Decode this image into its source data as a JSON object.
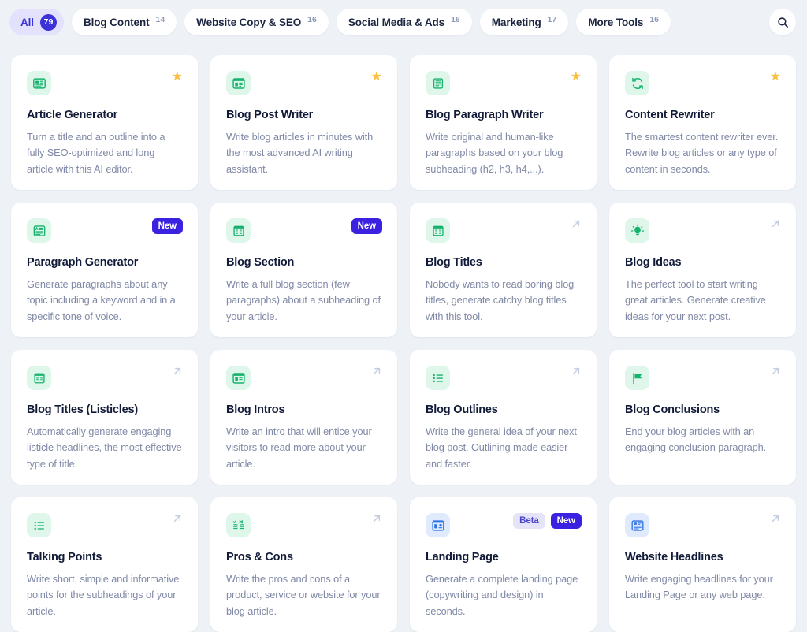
{
  "theme": {
    "page_background": "#eef2f7",
    "accent_indigo": "#3b33d8",
    "badge_new_bg": "#3b21e0",
    "badge_beta_bg": "#e5e3f8",
    "star_color": "#fbbf3c",
    "icon_tile_green": "#dff6ea",
    "icon_tile_blue": "#dfeafc",
    "icon_green": "#16b36e",
    "icon_blue": "#2f72e8"
  },
  "topbar": {
    "search_icon": "search-icon",
    "tabs": [
      {
        "label": "All",
        "count": "79",
        "active": true
      },
      {
        "label": "Blog Content",
        "count": "14",
        "active": false
      },
      {
        "label": "Website Copy & SEO",
        "count": "16",
        "active": false
      },
      {
        "label": "Social Media & Ads",
        "count": "16",
        "active": false
      },
      {
        "label": "Marketing",
        "count": "17",
        "active": false
      },
      {
        "label": "More Tools",
        "count": "16",
        "active": false
      }
    ]
  },
  "cards": [
    {
      "title": "Article Generator",
      "desc": "Turn a title and an outline into a fully SEO-optimized and long article with this AI editor.",
      "icon": "article-icon",
      "icon_color": "green",
      "marker": "star",
      "badges": []
    },
    {
      "title": "Blog Post Writer",
      "desc": "Write blog articles in minutes with the most advanced AI writing assistant.",
      "icon": "blog-post-icon",
      "icon_color": "green",
      "marker": "star",
      "badges": []
    },
    {
      "title": "Blog Paragraph Writer",
      "desc": "Write original and human-like paragraphs based on your blog subheading (h2, h3, h4,...).",
      "icon": "paragraph-lines-icon",
      "icon_color": "green",
      "marker": "star",
      "badges": []
    },
    {
      "title": "Content Rewriter",
      "desc": "The smartest content rewriter ever. Rewrite blog articles or any type of content in seconds.",
      "icon": "refresh-cycle-icon",
      "icon_color": "green",
      "marker": "star",
      "badges": []
    },
    {
      "title": "Paragraph Generator",
      "desc": "Generate paragraphs about any topic including a keyword and in a specific tone of voice.",
      "icon": "paragraph-generator-icon",
      "icon_color": "green",
      "marker": "badges",
      "badges": [
        "New"
      ]
    },
    {
      "title": "Blog Section",
      "desc": "Write a full blog section (few paragraphs) about a subheading of your article.",
      "icon": "blog-section-icon",
      "icon_color": "green",
      "marker": "badges",
      "badges": [
        "New"
      ]
    },
    {
      "title": "Blog Titles",
      "desc": "Nobody wants to read boring blog titles, generate catchy blog titles with this tool.",
      "icon": "blog-titles-icon",
      "icon_color": "green",
      "marker": "arrow",
      "badges": []
    },
    {
      "title": "Blog Ideas",
      "desc": "The perfect tool to start writing great articles. Generate creative ideas for your next post.",
      "icon": "lightbulb-icon",
      "icon_color": "green",
      "marker": "arrow",
      "badges": []
    },
    {
      "title": "Blog Titles (Listicles)",
      "desc": "Automatically generate engaging listicle headlines, the most effective type of title.",
      "icon": "listicle-icon",
      "icon_color": "green",
      "marker": "arrow",
      "badges": []
    },
    {
      "title": "Blog Intros",
      "desc": "Write an intro that will entice your visitors to read more about your article.",
      "icon": "blog-intro-icon",
      "icon_color": "green",
      "marker": "arrow",
      "badges": []
    },
    {
      "title": "Blog Outlines",
      "desc": "Write the general idea of your next blog post. Outlining made easier and faster.",
      "icon": "outline-list-icon",
      "icon_color": "green",
      "marker": "arrow",
      "badges": []
    },
    {
      "title": "Blog Conclusions",
      "desc": "End your blog articles with an engaging conclusion paragraph.",
      "icon": "flag-icon",
      "icon_color": "green",
      "marker": "arrow",
      "badges": []
    },
    {
      "title": "Talking Points",
      "desc": "Write short, simple and informative points for the subheadings of your article.",
      "icon": "bullet-list-icon",
      "icon_color": "green",
      "marker": "arrow",
      "badges": []
    },
    {
      "title": "Pros & Cons",
      "desc": "Write the pros and cons of a product, service or website for your blog article.",
      "icon": "pros-cons-icon",
      "icon_color": "green",
      "marker": "arrow",
      "badges": []
    },
    {
      "title": "Landing Page",
      "desc": "Generate a complete landing page (copywriting and design) in seconds.",
      "icon": "landing-page-icon",
      "icon_color": "blue",
      "marker": "badges",
      "badges": [
        "Beta",
        "New"
      ]
    },
    {
      "title": "Website Headlines",
      "desc": "Write engaging headlines for your Landing Page or any web page.",
      "icon": "website-headline-icon",
      "icon_color": "blue",
      "marker": "arrow",
      "badges": []
    }
  ]
}
